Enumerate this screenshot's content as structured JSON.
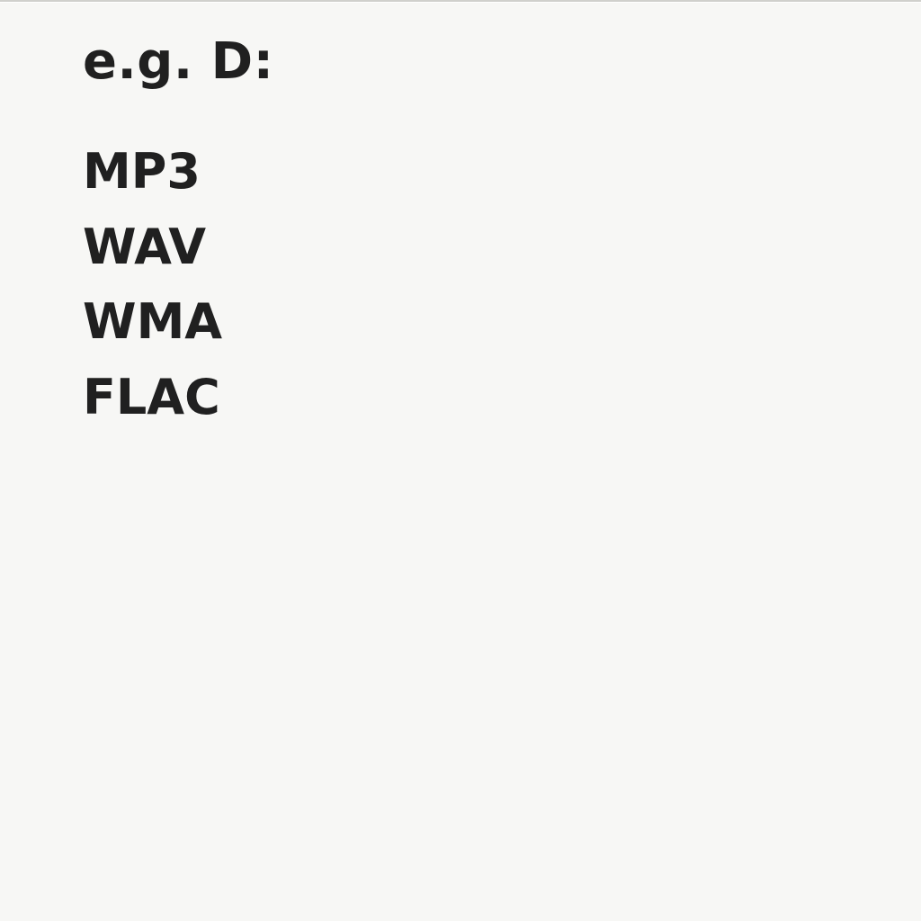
{
  "placeholder_label": "e.g. D:",
  "formats": {
    "items": [
      "MP3",
      "WAV",
      "WMA",
      "FLAC"
    ]
  }
}
